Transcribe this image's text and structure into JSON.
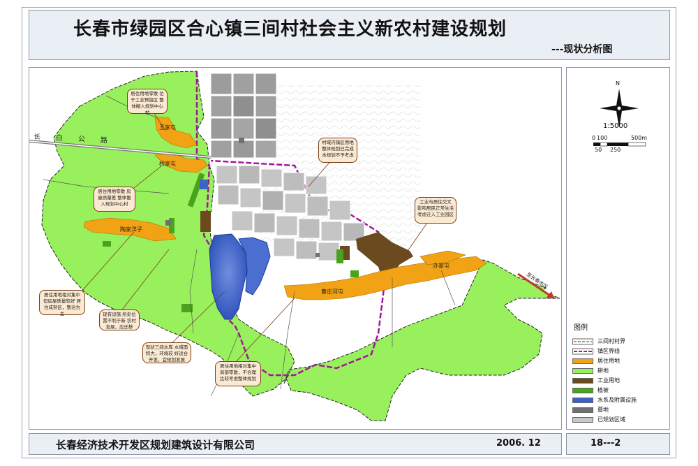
{
  "header": {
    "title": "长春市绿园区合心镇三间村社会主义新农村建设规划",
    "subtitle": "---现状分析图"
  },
  "map": {
    "road_label": "长白公路",
    "direction_label": "至长春市区",
    "places": {
      "wang_jia_tun": "王家屯",
      "qiao_jia_tun": "桥家屯",
      "tao_jia_yangzi": "陶家洋子",
      "wang_jia_tun_east": "办家屯",
      "cao_zhang_he_tun": "曹庄河屯"
    },
    "notes": [
      "居住用地零散 位于工业预留区 整体搬入规划中心村",
      "村域内镇区用地 整体规划已完成 本规划不予考虑",
      "居住用地零散 房屋质量差 整体搬入规划中心村",
      "工业与居住交叉 影响居民正常生活 考虑迁入工业园区",
      "居住用地相对集中 但房屋质量较好 居住成熟区，整治为主",
      "现有设施 所处位置不利于新 农村发展，应迁移",
      "现状三间水库 水域面积大，环境较 好适合开发，宜规划发展",
      "居住用地相对集中 局部零散，不合理 比较考虑整体规划"
    ],
    "colors": {
      "farmland": "#99f05d",
      "residential": "#f2a315",
      "industrial": "#6b4a1f",
      "vegetation": "#4aa31c",
      "water": "#3e63c8",
      "cemetery": "#707070",
      "planned": "#c8c8c8",
      "boundary": "#a0189a"
    }
  },
  "side": {
    "north_label": "N",
    "scale_ratio": "1:5000",
    "scale_ticks_top": [
      "0",
      "100",
      "500m"
    ],
    "scale_ticks_bottom": [
      "50",
      "250"
    ],
    "legend_title": "图例",
    "legend": [
      {
        "label": "三间村村界",
        "icon": "dash-line-icon"
      },
      {
        "label": "镇区界线",
        "icon": "purple-dash-line-icon"
      },
      {
        "label": "居住用地",
        "color": "#f2a315"
      },
      {
        "label": "耕地",
        "color": "#99f05d"
      },
      {
        "label": "工业用地",
        "color": "#6b4a1f"
      },
      {
        "label": "植被",
        "color": "#4aa31c"
      },
      {
        "label": "水系及附属设施",
        "color": "#3e63c8"
      },
      {
        "label": "墓地",
        "color": "#707070"
      },
      {
        "label": "已规划区域",
        "color": "#c8c8c8"
      }
    ]
  },
  "footer": {
    "company": "长春经济技术开发区规划建筑设计有限公司",
    "date": "2006. 12",
    "sheet": "18---2"
  }
}
